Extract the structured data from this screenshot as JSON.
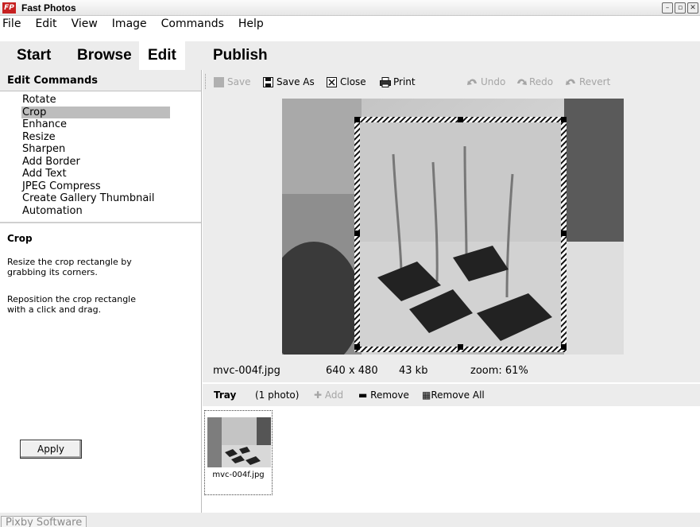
{
  "window": {
    "title": "Fast Photos",
    "logo_text": "FP",
    "controls": [
      "–",
      "▫",
      "✕"
    ]
  },
  "menu": [
    "File",
    "Edit",
    "View",
    "Image",
    "Commands",
    "Help"
  ],
  "nav_tabs": [
    "Start",
    "Browse",
    "Edit",
    "Publish"
  ],
  "active_tab": "Edit",
  "sidebar": {
    "heading": "Edit Commands",
    "commands": [
      "Rotate",
      "Crop",
      "Enhance",
      "Resize",
      "Sharpen",
      "Add Border",
      "Add Text",
      "JPEG Compress",
      "Create Gallery Thumbnail",
      "Automation"
    ],
    "selected": "Crop",
    "help_title": "Crop",
    "help_paragraph_1": "Resize the crop rectangle by\ngrabbing  its corners.",
    "help_paragraph_2": "Reposition the crop rectangle\nwith a click and drag.",
    "apply_label": "Apply"
  },
  "toolbar": {
    "save": "Save",
    "save_as": "Save As",
    "close": "Close",
    "print": "Print",
    "undo": "Undo",
    "redo": "Redo",
    "revert": "Revert"
  },
  "status": {
    "filename": "mvc-004f.jpg",
    "dimensions": "640 x 480",
    "size": "43 kb",
    "zoom": "zoom: 61%"
  },
  "tray": {
    "label": "Tray",
    "count": "(1 photo)",
    "add": "Add",
    "remove": "Remove",
    "remove_all": "Remove All",
    "items": [
      {
        "caption": "mvc-004f.jpg"
      }
    ]
  },
  "footer": {
    "vendor": "Pixby Software"
  },
  "colors": {
    "panel_bg": "#ececec",
    "selection": "#bdbdbd",
    "disabled_text": "#a5a5a5",
    "logo_red": "#c62020"
  }
}
